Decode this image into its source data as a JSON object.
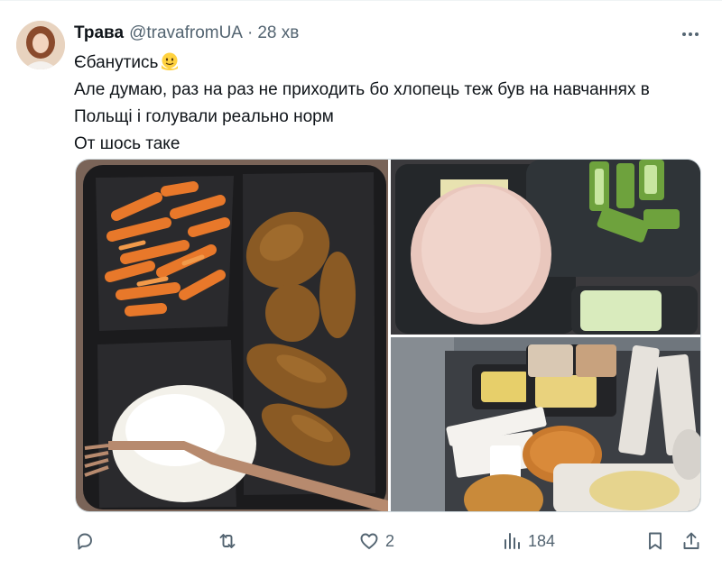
{
  "tweet": {
    "author": {
      "display_name": "Трава",
      "handle": "@travafromUA",
      "avatar_icon": "avatar"
    },
    "separator": "·",
    "timestamp": "28 хв",
    "lines": [
      "Єбанутись",
      "Але думаю, раз на раз не приходить бо хлопець теж був на навчаннях в",
      "Польщі і голували реально норм",
      "От шось таке"
    ],
    "emoji": "melting-face-emoji"
  },
  "actions": {
    "reply": {
      "icon": "reply-icon",
      "count": ""
    },
    "retweet": {
      "icon": "retweet-icon",
      "count": ""
    },
    "like": {
      "icon": "heart-icon",
      "count": "2"
    },
    "views": {
      "icon": "views-chart-icon",
      "count": "184"
    },
    "bookmark": {
      "icon": "bookmark-icon"
    },
    "share": {
      "icon": "share-icon"
    }
  },
  "colors": {
    "text": "#0f1419",
    "secondary": "#536471",
    "border": "#cfd9de"
  }
}
